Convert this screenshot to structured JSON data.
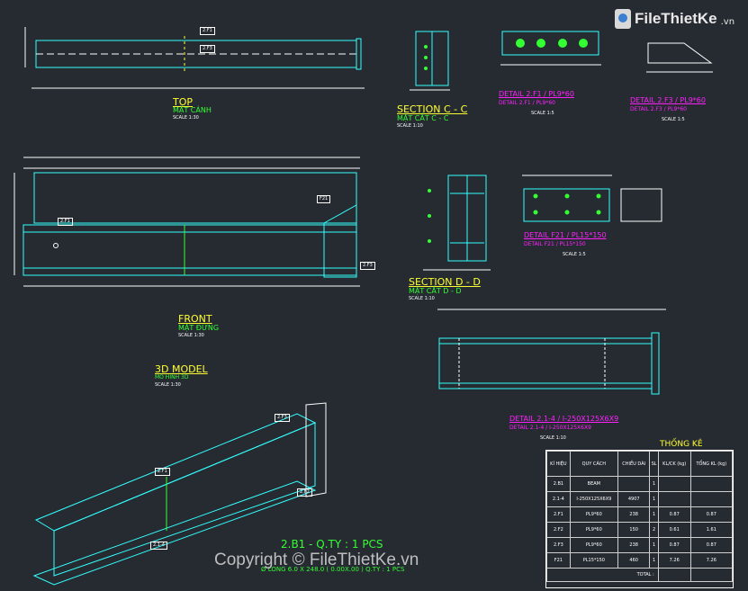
{
  "brand": {
    "name": "FileThietKe",
    "tld": ".vn"
  },
  "watermark": "Copyright © FileThietKe.vn",
  "views": {
    "top": {
      "title": "TOP",
      "subtitle": "MẶT CÁNH",
      "scale": "SCALE 1:30"
    },
    "section_cc": {
      "title": "SECTION  C - C",
      "subtitle": "MẶT CẮT  C - C",
      "scale": "SCALE 1:10"
    },
    "detail_f1": {
      "title": "DETAIL  2.F1 / PL9*60",
      "subtitle": "DETAIL  2.F1 / PL9*60",
      "scale": "SCALE 1:5"
    },
    "detail_f3": {
      "title": "DETAIL  2.F3 / PL9*60",
      "subtitle": "DETAIL  2.F3 / PL9*60",
      "scale": "SCALE 1:5"
    },
    "front": {
      "title": "FRONT",
      "subtitle": "MẶT ĐỨNG",
      "scale": "SCALE 1:30"
    },
    "section_dd": {
      "title": "SECTION  D - D",
      "subtitle": "MẶT CẮT  D - D",
      "scale": "SCALE 1:10"
    },
    "detail_f21": {
      "title": "DETAIL  F21 / PL15*150",
      "subtitle": "DETAIL  F21 / PL15*150",
      "scale": "SCALE 1:5"
    },
    "model3d": {
      "title": "3D MODEL",
      "subtitle": "MÔ HÌNH 3D",
      "scale": "SCALE 1:30"
    },
    "detail_214": {
      "title": "DETAIL  2.1-4  / I-250X125X6X9",
      "subtitle": "DETAIL  2.1-4  / I-250X125X6X9",
      "scale": "SCALE 1:10"
    }
  },
  "part_caption": "2.B1 -  Q.TY  :  1  PCS",
  "part_subcaption": "Ø LONG 6.0 X 248.0 ( 0.00X.00 )       Q.TY :    1  PCS",
  "table": {
    "title": "THỐNG KÊ",
    "headers": [
      "KÍ HIỆU",
      "QUY CÁCH",
      "CHIỀU DÀI",
      "SL",
      "KL/CK (kg)",
      "TỔNG KL (kg)"
    ],
    "rows": [
      [
        "2.B1",
        "BEAM",
        "",
        "1",
        "",
        ""
      ],
      [
        "2.1-4",
        "I-250X125X6X9",
        "4907",
        "1",
        "",
        ""
      ],
      [
        "2.F1",
        "PL9*60",
        "238",
        "1",
        "0.87",
        "0.87"
      ],
      [
        "2.F2",
        "PL9*60",
        "150",
        "2",
        "0.61",
        "1.61"
      ],
      [
        "2.F3",
        "PL9*60",
        "238",
        "1",
        "0.87",
        "0.87"
      ],
      [
        "F21",
        "PL15*150",
        "460",
        "1",
        "7.26",
        "7.26"
      ]
    ],
    "total_label": "TOTAL :",
    "total_values": [
      "",
      ""
    ]
  },
  "tags": {
    "top_a": "2.F1",
    "top_b": "2.F3",
    "front_web": "2.F1",
    "front_plate": "F21",
    "front_end": "2.F3",
    "beam3d_a": "2.F1",
    "beam3d_b": "2.F3",
    "beam3d_c": "2.F2",
    "beam3d_d": "2.1-4"
  }
}
